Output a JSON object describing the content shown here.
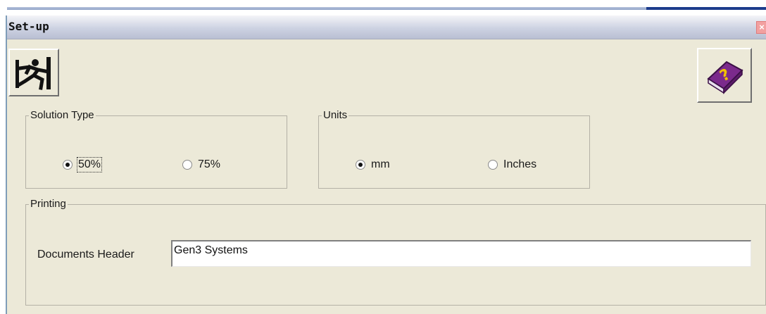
{
  "window": {
    "title": "Set-up",
    "close_glyph": "×",
    "toolbar": {
      "exit_icon": "exit-running-man-icon",
      "help_icon": "help-book-icon"
    }
  },
  "solution_type": {
    "label": "Solution Type",
    "options": [
      {
        "label": "50%",
        "selected": true
      },
      {
        "label": "75%",
        "selected": false
      }
    ]
  },
  "units": {
    "label": "Units",
    "options": [
      {
        "label": "mm",
        "selected": true
      },
      {
        "label": "Inches",
        "selected": false
      }
    ]
  },
  "printing": {
    "label": "Printing",
    "documents_header_label": "Documents Header",
    "documents_header_value": "Gen3 Systems"
  },
  "colors": {
    "dialog_bg": "#ece9d8",
    "titlebar": "#cdd2e2",
    "close_button": "#f2a0a0",
    "help_book": "#7b2a8c"
  }
}
